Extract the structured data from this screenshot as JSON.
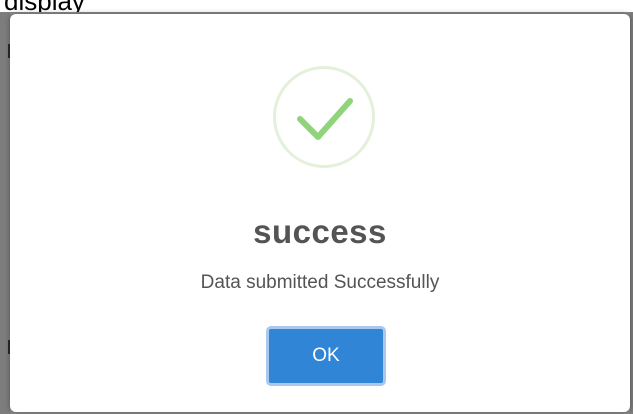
{
  "background": {
    "partial_heading": "display"
  },
  "dialog": {
    "icon": "checkmark-icon",
    "title": "success",
    "message": "Data submitted Successfully",
    "ok_label": "OK"
  },
  "colors": {
    "accent": "#3085d6",
    "success_green": "#8fd47a",
    "text": "#545454"
  }
}
